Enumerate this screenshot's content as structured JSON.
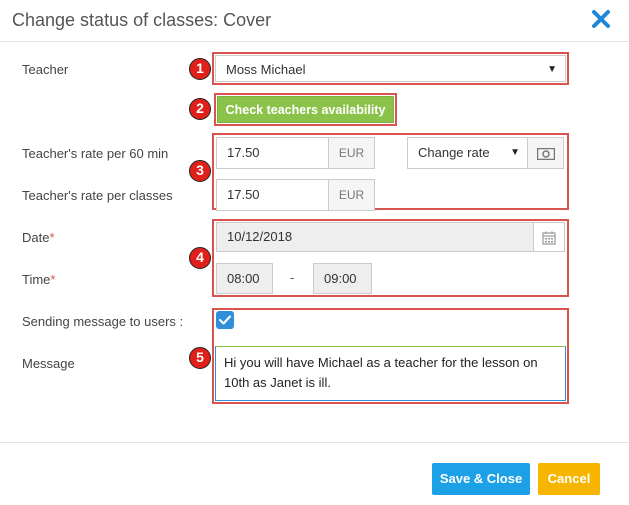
{
  "dialog": {
    "title": "Change status of classes: Cover"
  },
  "labels": {
    "teacher": "Teacher",
    "rate60": "Teacher's rate per 60 min",
    "rate_classes": "Teacher's rate per classes",
    "date": "Date",
    "time": "Time",
    "required_mark": "*",
    "sending_message": "Sending message to users :",
    "message": "Message"
  },
  "teacher_select": {
    "value": "Moss Michael",
    "arrow": "▼"
  },
  "check_button": {
    "label": "Check teachers availability"
  },
  "rate": {
    "per60_value": "17.50",
    "per60_currency": "EUR",
    "per_classes_value": "17.50",
    "per_classes_currency": "EUR",
    "change_rate": "Change rate",
    "change_rate_arrow": "▼"
  },
  "date": {
    "value": "10/12/2018"
  },
  "time": {
    "start": "08:00",
    "separator": "-",
    "end": "09:00"
  },
  "sending_message": {
    "checked": true
  },
  "message": {
    "text": "Hi you will have Michael as a teacher for the lesson on 10th as Janet is ill."
  },
  "annotations": [
    "1",
    "2",
    "3",
    "4",
    "5"
  ],
  "footer": {
    "save_label": "Save & Close",
    "cancel_label": "Cancel"
  },
  "colors": {
    "annotation_red": "#d9534f",
    "check_green": "#8bc34a",
    "save_blue": "#1da1e6",
    "cancel_yellow": "#f7b500",
    "close_blue": "#1e88d6"
  },
  "icons": [
    "close-icon",
    "calendar-icon",
    "money-icon",
    "checkmark-icon",
    "dropdown-arrow-icon"
  ]
}
